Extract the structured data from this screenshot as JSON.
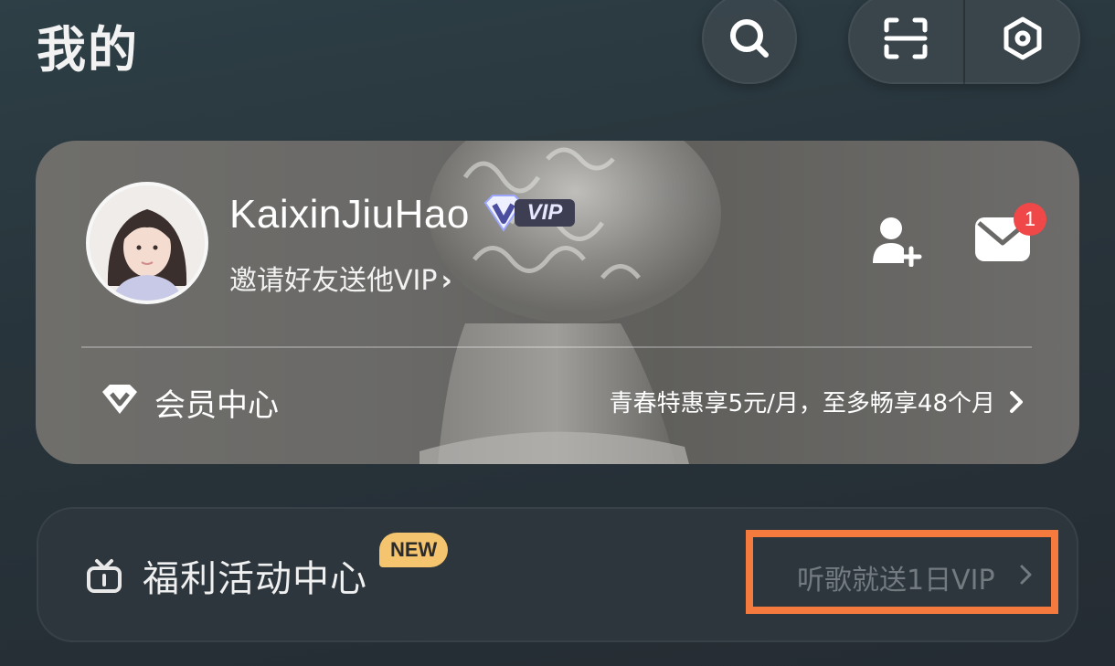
{
  "header": {
    "title": "我的",
    "icons": [
      "search-icon",
      "scan-icon",
      "settings-icon"
    ]
  },
  "user": {
    "name": "KaixinJiuHao",
    "vip_label": "VIP",
    "invite_text": "邀请好友送他VIP",
    "invite_chevron": "›",
    "mail_badge": "1"
  },
  "membership": {
    "label": "会员中心",
    "promo": "青春特惠享5元/月，至多畅享48个月"
  },
  "welfare": {
    "title": "福利活动中心",
    "badge": "NEW",
    "link_text": "听歌就送1日VIP"
  },
  "colors": {
    "accent_orange": "#f47a3e",
    "badge_red": "#f04848",
    "new_badge": "#f4c56e"
  }
}
